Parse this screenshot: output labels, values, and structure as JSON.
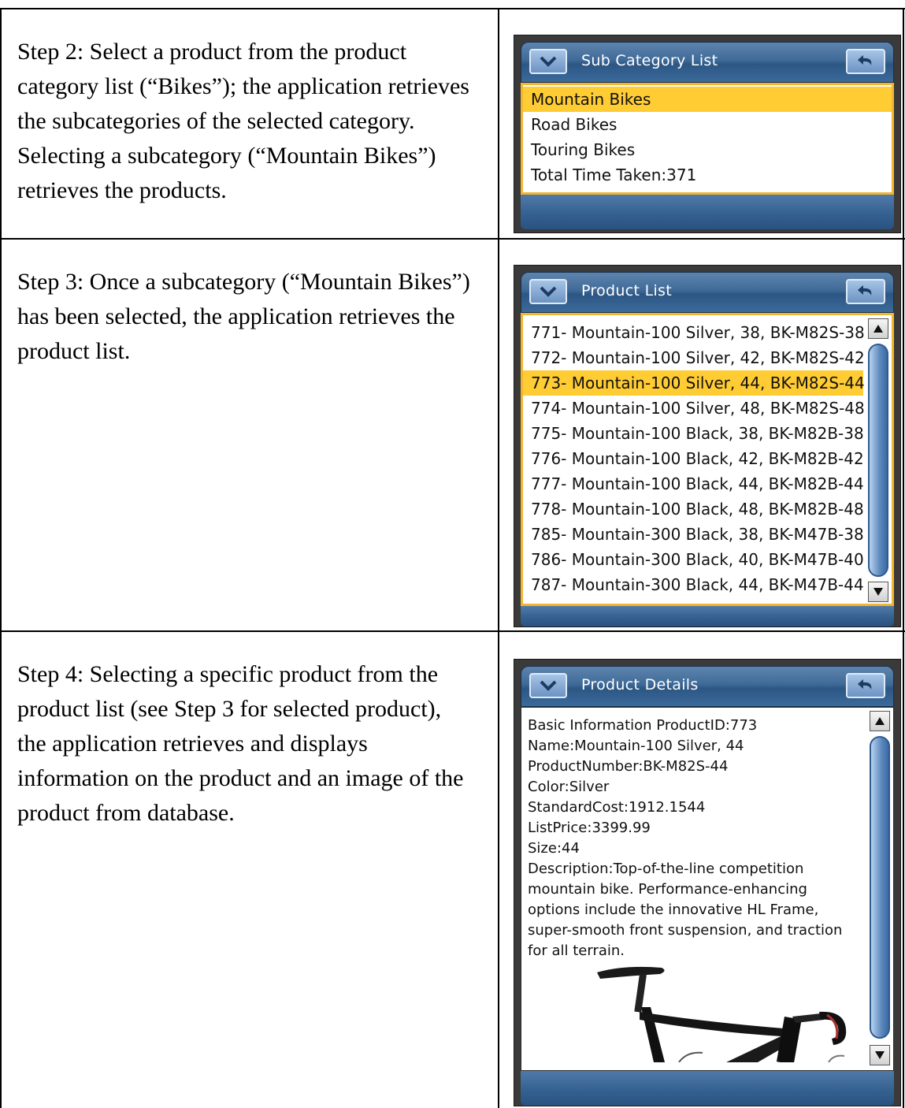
{
  "steps": [
    {
      "text": "Step 2: Select a product from the product category list (“Bikes”); the application retrieves the subcategories of the selected category.  Selecting a subcategory (“Mountain Bikes”) retrieves the products."
    },
    {
      "text": "Step 3: Once a subcategory (“Mountain Bikes”) has been selected, the application retrieves the product list."
    },
    {
      "text": "Step 4: Selecting a specific product from the product list (see Step 3 for selected product), the application retrieves and displays information on the product and an image of the product from database."
    }
  ],
  "subcategory_window": {
    "title": "Sub Category List",
    "items": [
      "Mountain Bikes",
      "Road Bikes",
      "Touring Bikes",
      "Total Time Taken:371"
    ],
    "selected_index": 0
  },
  "product_window": {
    "title": "Product List",
    "items": [
      "771- Mountain-100 Silver, 38, BK-M82S-38",
      "772- Mountain-100 Silver, 42, BK-M82S-42",
      "773- Mountain-100 Silver, 44, BK-M82S-44",
      "774- Mountain-100 Silver, 48, BK-M82S-48",
      "775- Mountain-100 Black, 38, BK-M82B-38",
      "776- Mountain-100 Black, 42, BK-M82B-42",
      "777- Mountain-100 Black, 44, BK-M82B-44",
      "778- Mountain-100 Black, 48, BK-M82B-48",
      "785- Mountain-300 Black, 38, BK-M47B-38",
      "786- Mountain-300 Black, 40, BK-M47B-40",
      "787- Mountain-300 Black, 44, BK-M47B-44"
    ],
    "selected_index": 2
  },
  "details_window": {
    "title": "Product Details",
    "lines": [
      "Basic Information ProductID:773",
      "Name:Mountain-100 Silver, 44",
      "ProductNumber:BK-M82S-44",
      "Color:Silver",
      "StandardCost:1912.1544",
      "ListPrice:3399.99",
      "Size:44",
      "Description:Top-of-the-line competition mountain bike. Performance-enhancing options include the innovative HL Frame, super-smooth front suspension, and traction for all terrain."
    ]
  },
  "icons": {
    "menu": "chevron-down-icon",
    "back": "back-arrow-icon",
    "scroll_up": "scroll-up-arrow-icon",
    "scroll_down": "scroll-down-arrow-icon",
    "product_image": "bike-image"
  },
  "colors": {
    "selection": "#ffcc33",
    "title_bar": "#3f6a98",
    "content_border": "#f2b531"
  }
}
